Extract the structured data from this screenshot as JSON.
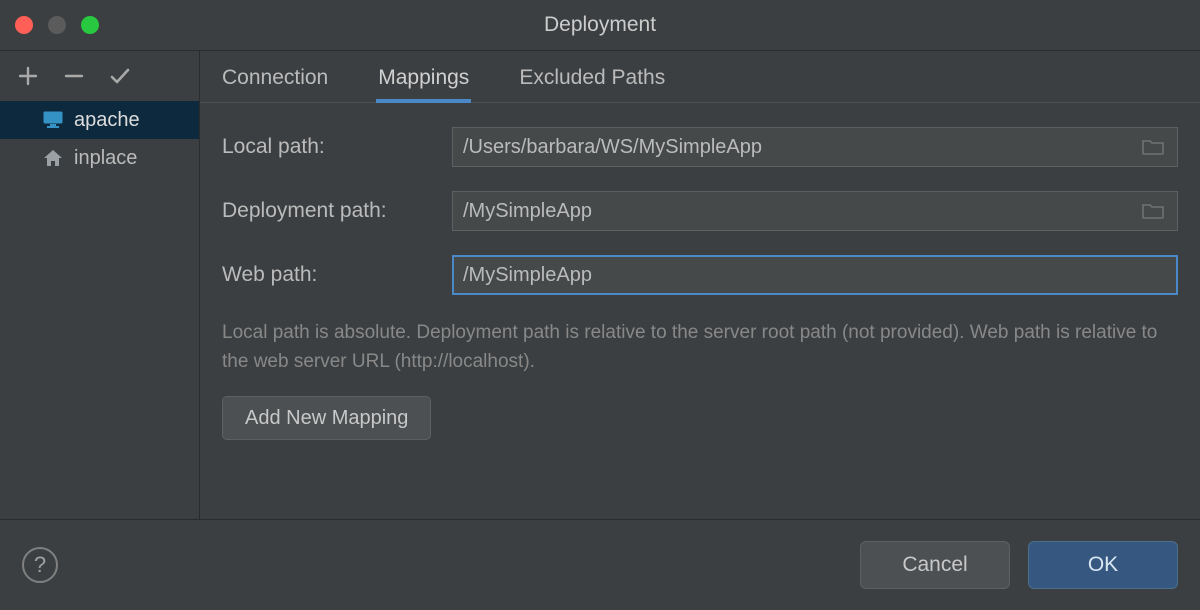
{
  "window": {
    "title": "Deployment"
  },
  "sidebar": {
    "servers": [
      {
        "name": "apache",
        "icon": "server-monitor-icon",
        "selected": true
      },
      {
        "name": "inplace",
        "icon": "home-icon",
        "selected": false
      }
    ]
  },
  "tabs": [
    {
      "id": "connection",
      "label": "Connection",
      "active": false
    },
    {
      "id": "mappings",
      "label": "Mappings",
      "active": true
    },
    {
      "id": "excluded",
      "label": "Excluded Paths",
      "active": false
    }
  ],
  "form": {
    "local_path_label": "Local path:",
    "local_path_value": "/Users/barbara/WS/MySimpleApp",
    "deployment_path_label": "Deployment path:",
    "deployment_path_value": "/MySimpleApp",
    "web_path_label": "Web path:",
    "web_path_value": "/MySimpleApp",
    "help_text": "Local path is absolute. Deployment path is relative to the server root path (not provided). Web path is relative to the web server URL (http://localhost).",
    "add_mapping_label": "Add New Mapping"
  },
  "footer": {
    "help_label": "?",
    "cancel_label": "Cancel",
    "ok_label": "OK"
  }
}
